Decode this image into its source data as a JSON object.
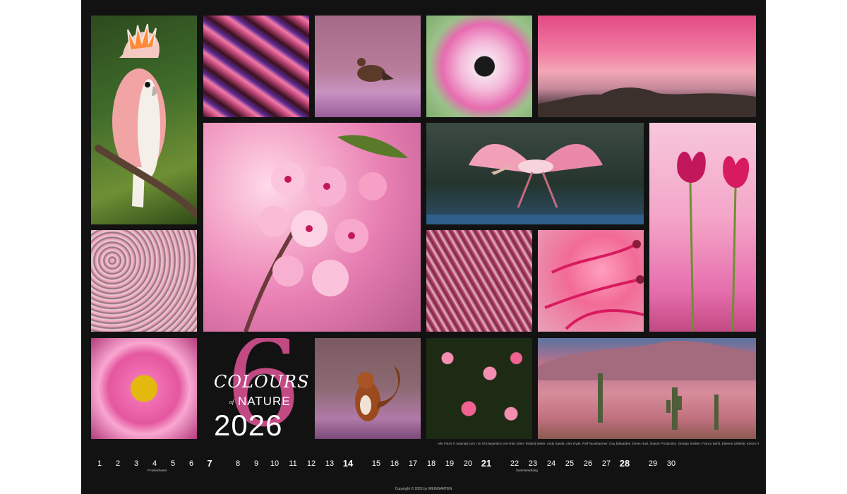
{
  "calendar": {
    "title_word1": "COLOURS",
    "title_of": "of",
    "title_word2": "NATURE",
    "year": "2026",
    "month_number": "6",
    "credits": "Alle Fotos © naturepl.com | Im Uhrzeigersinn von links oben: Roland Seitre, Andy Sands, Alex Hyde, Rolf Nussbaumer, Guy Edwardes, Denis Huot, Nature Production, George Sanker, Franco Banfi, Etienne Littlefair, Kenzo Hirose, Alan Williams, Peter Cairns, Steve Nichols, Jack Dykinga",
    "copyright": "Copyright © 2025 by WEINGARTEN"
  },
  "days": [
    {
      "label": "1",
      "sunday": false
    },
    {
      "label": "2",
      "sunday": false
    },
    {
      "label": "3",
      "sunday": false
    },
    {
      "label": "4",
      "sunday": false
    },
    {
      "label": "5",
      "sunday": false
    },
    {
      "label": "6",
      "sunday": false
    },
    {
      "label": "7",
      "sunday": true
    },
    {
      "label": "8",
      "sunday": false
    },
    {
      "label": "9",
      "sunday": false
    },
    {
      "label": "10",
      "sunday": false
    },
    {
      "label": "11",
      "sunday": false
    },
    {
      "label": "12",
      "sunday": false
    },
    {
      "label": "13",
      "sunday": false
    },
    {
      "label": "14",
      "sunday": true
    },
    {
      "label": "15",
      "sunday": false
    },
    {
      "label": "16",
      "sunday": false
    },
    {
      "label": "17",
      "sunday": false
    },
    {
      "label": "18",
      "sunday": false
    },
    {
      "label": "19",
      "sunday": false
    },
    {
      "label": "20",
      "sunday": false
    },
    {
      "label": "21",
      "sunday": true
    },
    {
      "label": "22",
      "sunday": false
    },
    {
      "label": "23",
      "sunday": false
    },
    {
      "label": "24",
      "sunday": false
    },
    {
      "label": "25",
      "sunday": false
    },
    {
      "label": "26",
      "sunday": false
    },
    {
      "label": "27",
      "sunday": false
    },
    {
      "label": "28",
      "sunday": true
    },
    {
      "label": "29",
      "sunday": false
    },
    {
      "label": "30",
      "sunday": false
    }
  ],
  "notes": {
    "fronleichnam": "Fronleichnam",
    "sommeranfang": "Sommeranfang"
  },
  "colors": {
    "background": "#121212",
    "accent_pink": "#c24a84"
  }
}
